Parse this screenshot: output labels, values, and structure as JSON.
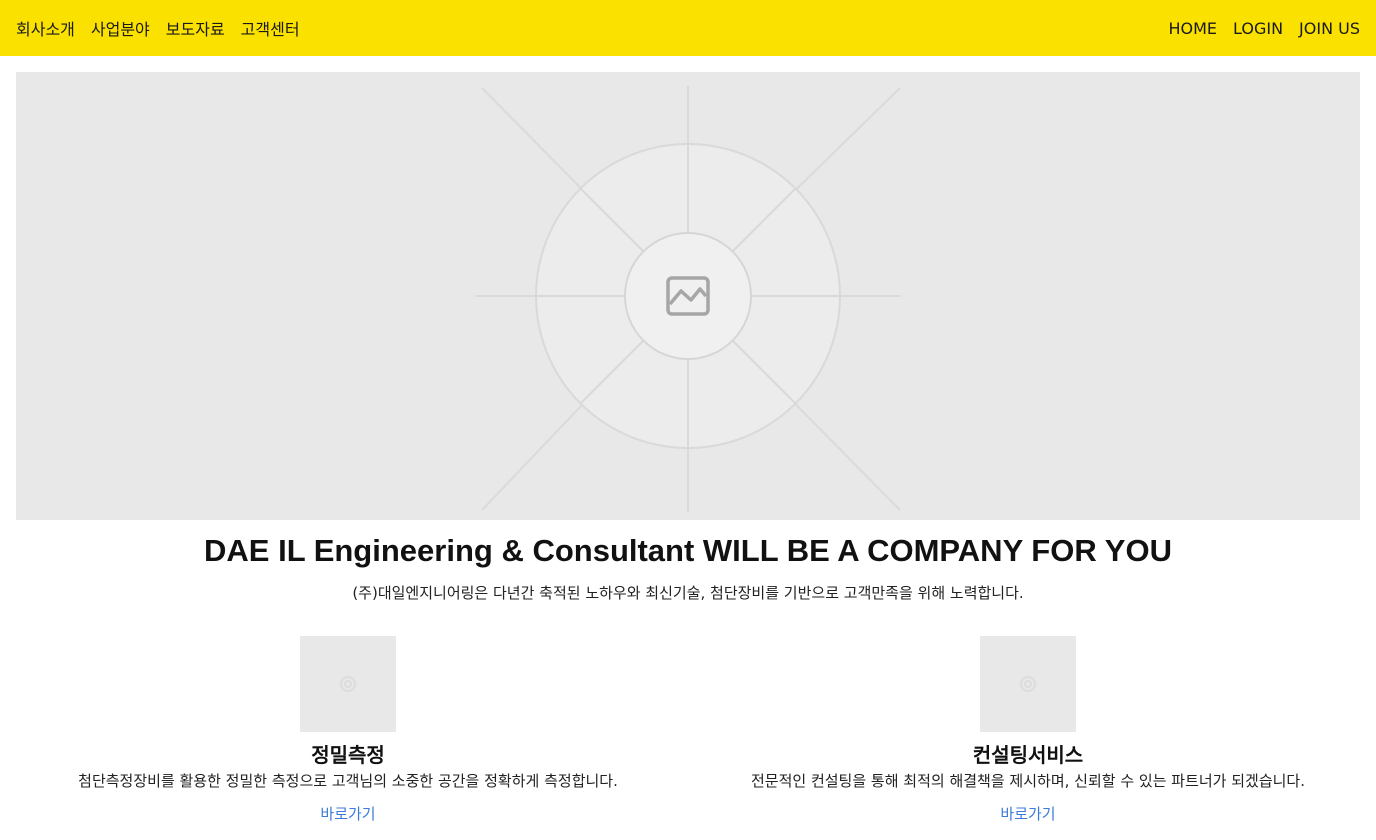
{
  "header": {
    "left_nav": [
      "회사소개",
      "사업분야",
      "보도자료",
      "고객센터"
    ],
    "right_nav": [
      "HOME",
      "LOGIN",
      "JOIN US"
    ],
    "background_color": "#fae100"
  },
  "hero": {
    "icon": "image-placeholder-icon"
  },
  "intro": {
    "headline": "DAE IL Engineering & Consultant WILL BE A COMPANY FOR YOU",
    "description": "(주)대일엔지니어링은 다년간 축적된 노하우와 최신기술, 첨단장비를 기반으로 고객만족을 위해 노력합니다."
  },
  "services": [
    {
      "title": "정밀측정",
      "description": "첨단측정장비를 활용한 정밀한 측정으로 고객님의 소중한 공간을 정확하게 측정합니다.",
      "link": "바로가기"
    },
    {
      "title": "컨설팅서비스",
      "description": "전문적인 컨설팅을 통해 최적의 해결책을 제시하며, 신뢰할 수 있는 파트너가 되겠습니다.",
      "link": "바로가기"
    }
  ],
  "colors": {
    "accent": "#fae100",
    "link": "#3d7bd9",
    "placeholder": "#e8e8e8"
  }
}
